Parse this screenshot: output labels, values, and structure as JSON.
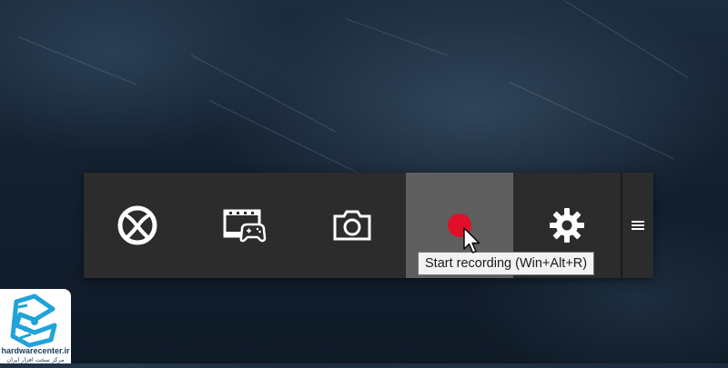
{
  "background": {
    "color": "#15212f"
  },
  "game_bar": {
    "buttons": [
      {
        "name": "xbox-button",
        "icon": "xbox-icon"
      },
      {
        "name": "game-dvr-button",
        "icon": "game-dvr-icon"
      },
      {
        "name": "screenshot-button",
        "icon": "camera-icon"
      },
      {
        "name": "record-button",
        "icon": "record-icon",
        "state": "hovered",
        "record_color": "#e0102a"
      },
      {
        "name": "settings-button",
        "icon": "gear-icon"
      }
    ],
    "more_button": {
      "icon": "menu-icon"
    },
    "bar_color": "#2c2c2c",
    "hover_color": "#5f5f5f"
  },
  "tooltip": {
    "text": "Start recording (Win+Alt+R)"
  },
  "watermark": {
    "brand_color": "#1fa3d9",
    "site": "hardwarecenter.ir",
    "tagline": "مرکز سخت افزار ایران"
  }
}
